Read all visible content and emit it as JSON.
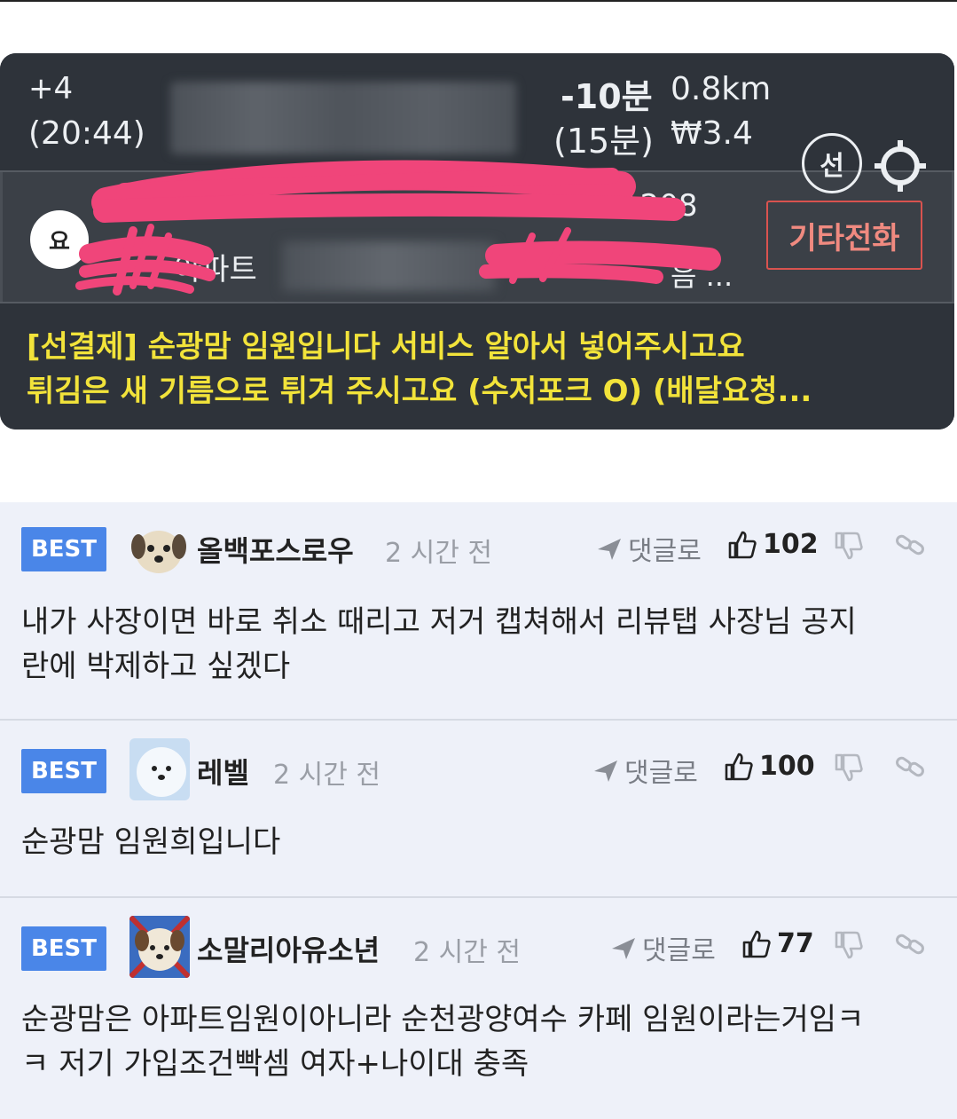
{
  "order": {
    "extra_count": "+4",
    "clock": "(20:44)",
    "eta_minus": "-10분",
    "eta_total": "(15분)",
    "distance": "0.8km",
    "fee": "₩3.4",
    "prepay_badge": "선",
    "order_type_badge": "요",
    "address_number": "1208",
    "address_apartment": "아파트",
    "address_tail": "음 ...",
    "call_button_label": "기타전화",
    "memo_line1": "[선결제] 순광맘 임원입니다 서비스 알아서 넣어주시고요",
    "memo_line2": "튀김은 새 기름으로 튀겨 주시고요 (수저포크 O) (배달요청..."
  },
  "comments": [
    {
      "badge": "BEST",
      "nickname": "올백포스로우",
      "time": "2 시간 전",
      "reply_label": "댓글로",
      "likes": "102",
      "text_line1": "내가 사장이면 바로 취소 때리고 저거 캡쳐해서 리뷰탭 사장님 공지",
      "text_line2": "란에 박제하고 싶겠다"
    },
    {
      "badge": "BEST",
      "nickname": "레벨",
      "time": "2 시간 전",
      "reply_label": "댓글로",
      "likes": "100",
      "text_line1": "순광맘 임원희입니다",
      "text_line2": ""
    },
    {
      "badge": "BEST",
      "nickname": "소말리아유소년",
      "time": "2 시간 전",
      "reply_label": "댓글로",
      "likes": "77",
      "text_line1": "순광맘은 아파트임원이아니라 순천광양여수 카페 임원이라는거임ㅋ",
      "text_line2": "ㅋ 저기 가입조건빡셈 여자+나이대 충족"
    }
  ],
  "icons": {
    "reply": "send-arrow-icon",
    "like": "thumbs-up-icon",
    "dislike": "thumbs-down-icon",
    "link": "link-icon",
    "target": "crosshair-icon"
  },
  "colors": {
    "card_bg": "#2e333a",
    "memo_text": "#f2e33a",
    "best_badge": "#4a86e8",
    "comment_bg": "#eef1f9",
    "redaction": "#f0457a"
  }
}
